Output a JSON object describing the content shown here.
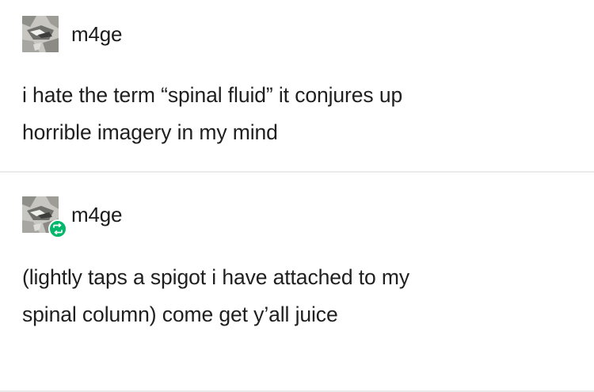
{
  "posts": [
    {
      "username": "m4ge",
      "text_lines": [
        "i hate the term “spinal fluid” it conjures up",
        "horrible imagery in my mind"
      ],
      "avatar_icon": "avatar-image",
      "reblog": false
    },
    {
      "username": "m4ge",
      "text_lines": [
        "(lightly taps a spigot i have attached to my",
        "spinal column) come get y’all juice"
      ],
      "avatar_icon": "avatar-image",
      "reblog": true,
      "reblog_icon": "reblog-icon",
      "reblog_color": "#00b86b"
    }
  ]
}
